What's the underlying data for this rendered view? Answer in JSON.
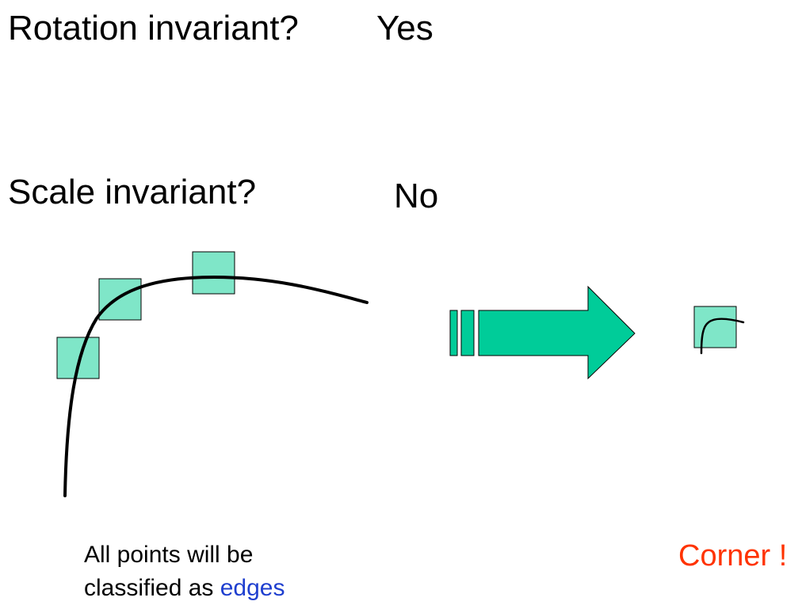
{
  "questions": [
    {
      "question": "Rotation invariant?",
      "answer": "Yes"
    },
    {
      "question": "Scale invariant?",
      "answer": "No"
    }
  ],
  "caption": {
    "line1": "All points will be",
    "line2_prefix": "classified as ",
    "line2_highlight": "edges"
  },
  "result": "Corner !",
  "colors": {
    "window_fill": "#7fe6c8",
    "arrow_fill": "#00cc99",
    "curve": "#000000",
    "edges_text": "#1f3fcf",
    "corner_text": "#ff3300"
  }
}
